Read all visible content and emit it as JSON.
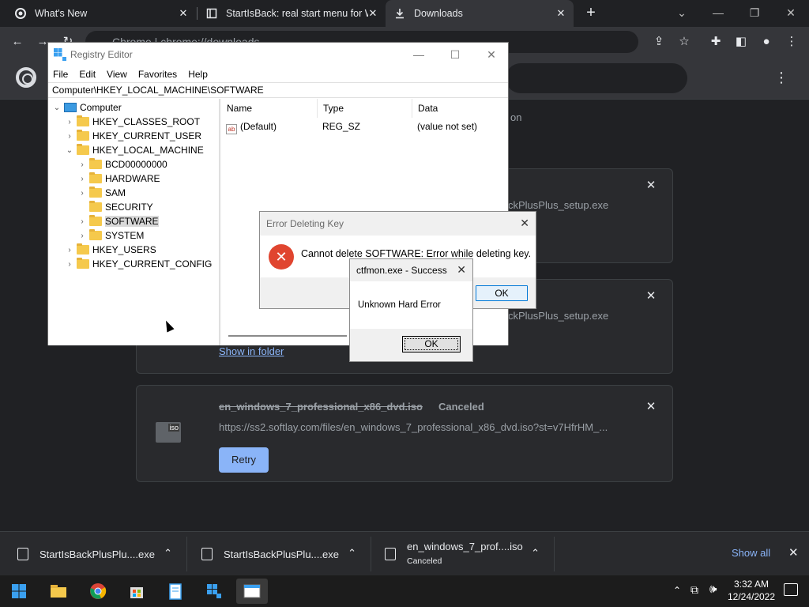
{
  "browser": {
    "tabs": [
      {
        "title": "What's New",
        "active": false
      },
      {
        "title": "StartIsBack: real start menu for W",
        "active": false
      },
      {
        "title": "Downloads",
        "active": true
      }
    ],
    "new_tab_symbol": "+",
    "omnibox": "Chrome  |  chrome://downloads",
    "window_controls": [
      "minimize",
      "restore",
      "close"
    ]
  },
  "downloads_page": {
    "partial_text_behind": "on",
    "cards": [
      {
        "file_partial": "ckPlusPlus_setup.exe"
      },
      {
        "file_partial": "ckPlusPlus_setup.exe",
        "link": "Show in folder"
      },
      {
        "file": "en_windows_7_professional_x86_dvd.iso",
        "status": "Canceled",
        "url": "https://ss2.softlay.com/files/en_windows_7_professional_x86_dvd.iso?st=v7HfrHM_...",
        "button": "Retry",
        "icon": "iso"
      }
    ]
  },
  "download_bar": {
    "items": [
      {
        "name": "StartIsBackPlusPlu....exe"
      },
      {
        "name": "StartIsBackPlusPlu....exe"
      },
      {
        "name": "en_windows_7_prof....iso",
        "sub": "Canceled",
        "icon": "iso"
      }
    ],
    "show_all": "Show all"
  },
  "regedit": {
    "title": "Registry Editor",
    "menu": [
      "File",
      "Edit",
      "View",
      "Favorites",
      "Help"
    ],
    "address": "Computer\\HKEY_LOCAL_MACHINE\\SOFTWARE",
    "tree": {
      "root": "Computer",
      "hives": [
        "HKEY_CLASSES_ROOT",
        "HKEY_CURRENT_USER",
        "HKEY_LOCAL_MACHINE"
      ],
      "hklm_children": [
        "BCD00000000",
        "HARDWARE",
        "SAM",
        "SECURITY",
        "SOFTWARE",
        "SYSTEM"
      ],
      "hives_after": [
        "HKEY_USERS",
        "HKEY_CURRENT_CONFIG"
      ]
    },
    "columns": [
      "Name",
      "Type",
      "Data"
    ],
    "values": [
      {
        "name": "(Default)",
        "type": "REG_SZ",
        "data": "(value not set)"
      }
    ]
  },
  "error_dialog": {
    "title": "Error Deleting Key",
    "message": "Cannot delete SOFTWARE:  Error while deleting key.",
    "ok": "OK"
  },
  "ctfmon_dialog": {
    "title": "ctfmon.exe - Success",
    "message": "Unknown Hard Error",
    "ok": "OK"
  },
  "taskbar": {
    "time": "3:32 AM",
    "date": "12/24/2022"
  },
  "colors": {
    "chrome_bg": "#202124",
    "chrome_toolbar": "#35363a",
    "accent_blue": "#8ab4f8",
    "error_red": "#e0452f",
    "folder_yellow": "#f5c94c"
  }
}
